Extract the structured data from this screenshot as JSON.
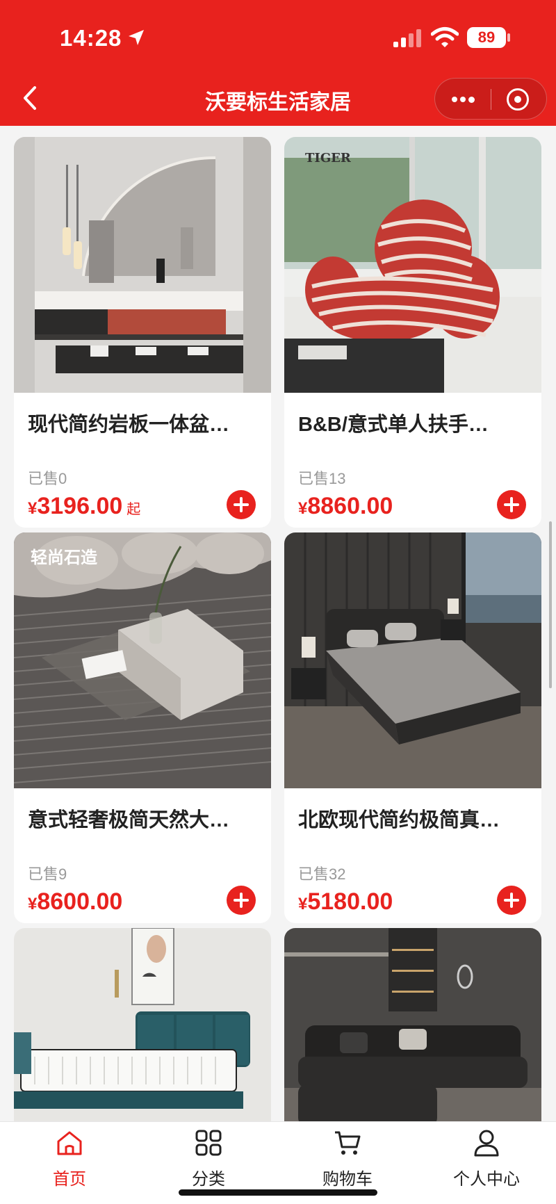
{
  "status_bar": {
    "time": "14:28",
    "battery": "89"
  },
  "nav": {
    "title": "沃要标生活家居"
  },
  "products": [
    {
      "name": "现代简约岩板一体盆…",
      "sold": "已售0",
      "currency": "¥",
      "price": "3196.00",
      "suffix": "起",
      "image": "bathroom-vanity-image"
    },
    {
      "name": "B&B/意式单人扶手…",
      "sold": "已售13",
      "currency": "¥",
      "price": "8860.00",
      "suffix": "",
      "image": "striped-armchair-image",
      "image_text": "TIGER"
    },
    {
      "name": "意式轻奢极简天然大…",
      "sold": "已售9",
      "currency": "¥",
      "price": "8600.00",
      "suffix": "",
      "image": "stone-coffee-table-image",
      "image_text": "轻尚石造"
    },
    {
      "name": "北欧现代简约极简真…",
      "sold": "已售32",
      "currency": "¥",
      "price": "5180.00",
      "suffix": "",
      "image": "leather-bed-image"
    },
    {
      "name": "",
      "sold": "",
      "currency": "",
      "price": "",
      "suffix": "",
      "image": "mattress-bed-image"
    },
    {
      "name": "",
      "sold": "",
      "currency": "",
      "price": "",
      "suffix": "",
      "image": "leather-sofa-image"
    }
  ],
  "tabbar": {
    "tabs": [
      {
        "label": "首页",
        "icon": "home-icon",
        "active": true
      },
      {
        "label": "分类",
        "icon": "grid-icon",
        "active": false
      },
      {
        "label": "购物车",
        "icon": "cart-icon",
        "active": false
      },
      {
        "label": "个人中心",
        "icon": "user-icon",
        "active": false
      }
    ]
  },
  "colors": {
    "brand": "#e8221e",
    "price": "#e8221e",
    "sold": "#999999",
    "active_tab": "#e8221e"
  }
}
